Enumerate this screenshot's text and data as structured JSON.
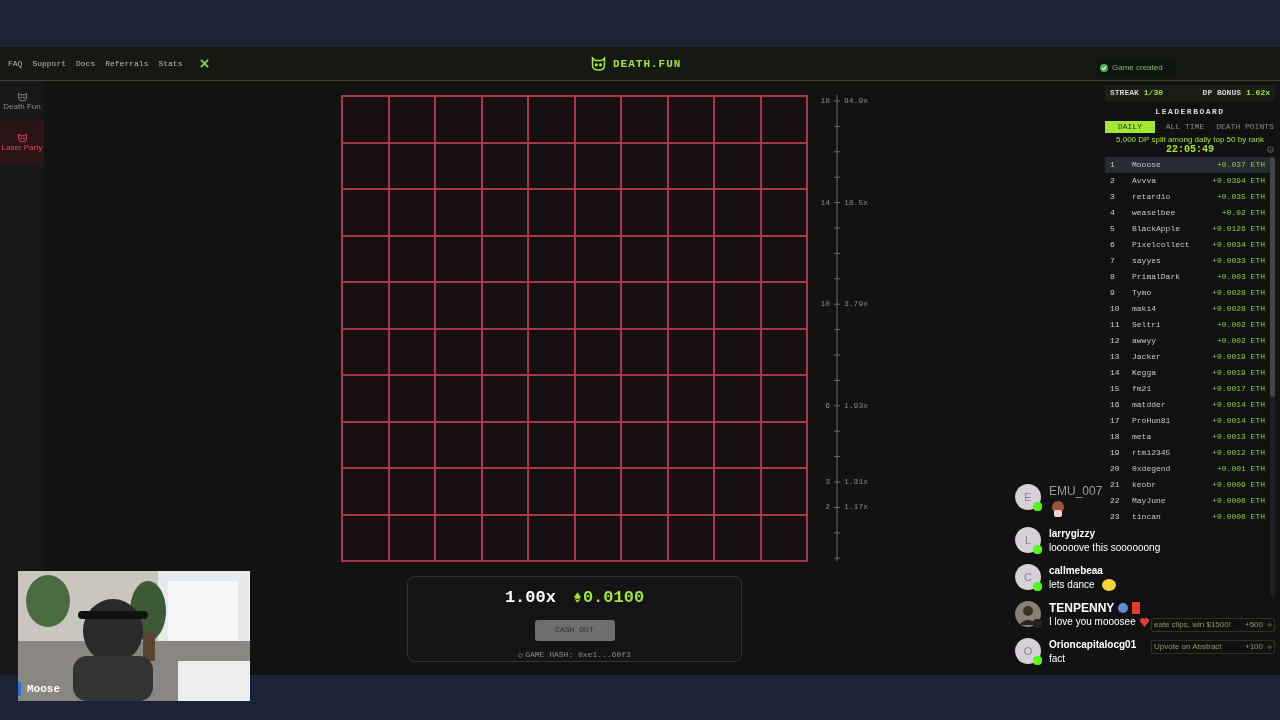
{
  "nav": {
    "links": [
      "FAQ",
      "Support",
      "Docs",
      "Referrals",
      "Stats"
    ]
  },
  "brand": {
    "name": "DEATH.FUN"
  },
  "toast": {
    "text": "Game created"
  },
  "sidebar": {
    "items": [
      {
        "label": "Death Fun",
        "selected": false
      },
      {
        "label": "Laser Party",
        "selected": true
      }
    ]
  },
  "scale": [
    {
      "level": "18",
      "multiplier": "94.9x"
    },
    {
      "level": "14",
      "multiplier": "18.5x"
    },
    {
      "level": "10",
      "multiplier": "3.79x"
    },
    {
      "level": "6",
      "multiplier": "1.93x"
    },
    {
      "level": "3",
      "multiplier": "1.31x"
    },
    {
      "level": "2",
      "multiplier": "1.17x"
    }
  ],
  "bet_panel": {
    "multiplier": "1.00x",
    "amount": "0.0100",
    "cash_out": {
      "label": "CASH OUT",
      "disabled": true
    },
    "hash": "GAME HASH: 0xe1...60f3"
  },
  "streak": {
    "label": "STREAK",
    "value": "1/30",
    "bonus_label": "DP BONUS",
    "bonus_value": "1.02x"
  },
  "leaderboard": {
    "title": "LEADERBOARD",
    "tabs": [
      {
        "label": "DAILY",
        "selected": true
      },
      {
        "label": "ALL TIME",
        "selected": false
      },
      {
        "label": "DEATH POINTS",
        "selected": false
      }
    ],
    "note": "5,000 DP split among daily top 50 by rank",
    "timer": "22:05:49",
    "rows": [
      {
        "rank": "1",
        "name": "Mooose",
        "amount": "+0.037 ETH",
        "selected": true
      },
      {
        "rank": "2",
        "name": "Avvva",
        "amount": "+0.0394 ETH",
        "selected": false
      },
      {
        "rank": "3",
        "name": "retardio",
        "amount": "+0.035 ETH",
        "selected": false
      },
      {
        "rank": "4",
        "name": "weaselbee",
        "amount": "+0.02 ETH",
        "selected": false
      },
      {
        "rank": "5",
        "name": "BlackApple",
        "amount": "+0.0126 ETH",
        "selected": false
      },
      {
        "rank": "6",
        "name": "Pixelcollect",
        "amount": "+0.0034 ETH",
        "selected": false
      },
      {
        "rank": "7",
        "name": "sayyes",
        "amount": "+0.0033 ETH",
        "selected": false
      },
      {
        "rank": "8",
        "name": "PrimalDark",
        "amount": "+0.003 ETH",
        "selected": false
      },
      {
        "rank": "9",
        "name": "Tymo",
        "amount": "+0.0028 ETH",
        "selected": false
      },
      {
        "rank": "10",
        "name": "maki4",
        "amount": "+0.0028 ETH",
        "selected": false
      },
      {
        "rank": "11",
        "name": "Seltri",
        "amount": "+0.002 ETH",
        "selected": false
      },
      {
        "rank": "12",
        "name": "awwyy",
        "amount": "+0.002 ETH",
        "selected": false
      },
      {
        "rank": "13",
        "name": "Jacker",
        "amount": "+0.0019 ETH",
        "selected": false
      },
      {
        "rank": "14",
        "name": "Kegga",
        "amount": "+0.0019 ETH",
        "selected": false
      },
      {
        "rank": "15",
        "name": "fm21",
        "amount": "+0.0017 ETH",
        "selected": false
      },
      {
        "rank": "16",
        "name": "matdder",
        "amount": "+0.0014 ETH",
        "selected": false
      },
      {
        "rank": "17",
        "name": "ProHun81",
        "amount": "+0.0014 ETH",
        "selected": false
      },
      {
        "rank": "18",
        "name": "meta",
        "amount": "+0.0013 ETH",
        "selected": false
      },
      {
        "rank": "19",
        "name": "rtm12345",
        "amount": "+0.0012 ETH",
        "selected": false
      },
      {
        "rank": "20",
        "name": "0xdegend",
        "amount": "+0.001 ETH",
        "selected": false
      },
      {
        "rank": "21",
        "name": "keobr",
        "amount": "+0.0009 ETH",
        "selected": false
      },
      {
        "rank": "22",
        "name": "MayJune",
        "amount": "+0.0008 ETH",
        "selected": false
      },
      {
        "rank": "23",
        "name": "tincan",
        "amount": "+0.0008 ETH",
        "selected": false
      }
    ]
  },
  "quests": [
    {
      "text": "eate clips, win $1500!",
      "reward": "+500"
    },
    {
      "text": "Upvote on Abstract",
      "reward": "+100"
    }
  ],
  "webcam": {
    "name": "Moose"
  },
  "chat": [
    {
      "kind": "emote",
      "user": "EMU_007",
      "avatar": "E"
    },
    {
      "kind": "text",
      "user": "larrygizzy",
      "avatar": "L",
      "text": "looooove this soooooong"
    },
    {
      "kind": "text",
      "user": "callmebeaa",
      "avatar": "C",
      "text": "lets dance"
    },
    {
      "user": "TENPENNY",
      "text": "I love you mooosee"
    },
    {
      "kind": "text",
      "user": "Orioncapitalocg01",
      "avatar": "O",
      "text": "fact"
    }
  ]
}
